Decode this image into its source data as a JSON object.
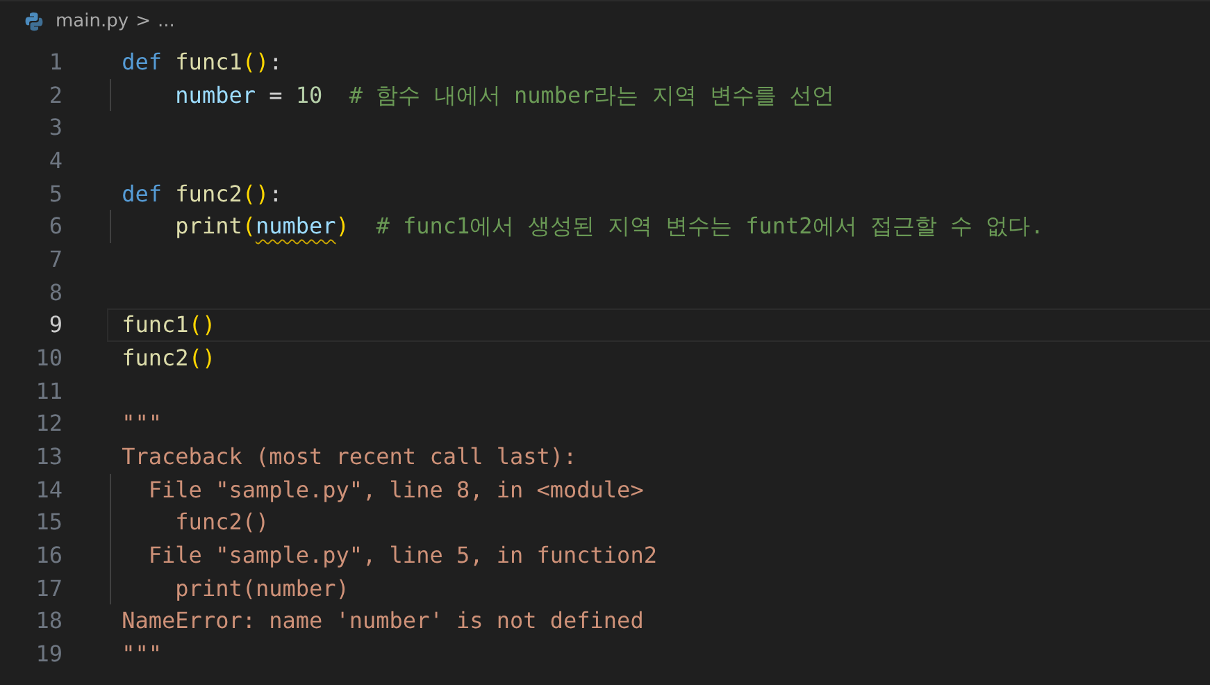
{
  "breadcrumb": {
    "file": "main.py",
    "separator": ">",
    "tail": "..."
  },
  "lines": [
    {
      "number": "1",
      "active": false,
      "tokens": [
        {
          "kind": "keyword",
          "text": "def "
        },
        {
          "kind": "function",
          "text": "func1"
        },
        {
          "kind": "bracket",
          "text": "()"
        },
        {
          "kind": "plain",
          "text": ":"
        }
      ]
    },
    {
      "number": "2",
      "active": false,
      "tokens": [
        {
          "kind": "variable",
          "text": "    number"
        },
        {
          "kind": "plain",
          "text": " = "
        },
        {
          "kind": "number",
          "text": "10"
        },
        {
          "kind": "comment",
          "text": "  # 함수 내에서 number라는 지역 변수를 선언"
        }
      ]
    },
    {
      "number": "3",
      "active": false
    },
    {
      "number": "4",
      "active": false
    },
    {
      "number": "5",
      "active": false,
      "tokens": [
        {
          "kind": "keyword",
          "text": "def "
        },
        {
          "kind": "function",
          "text": "func2"
        },
        {
          "kind": "bracket",
          "text": "()"
        },
        {
          "kind": "plain",
          "text": ":"
        }
      ]
    },
    {
      "number": "6",
      "active": false,
      "tokens": [
        {
          "kind": "function",
          "text": "    print"
        },
        {
          "kind": "bracket",
          "text": "("
        },
        {
          "kind": "warning",
          "text": "number"
        },
        {
          "kind": "bracket",
          "text": ")"
        },
        {
          "kind": "comment",
          "text": "  # func1에서 생성된 지역 변수는 funt2에서 접근할 수 없다."
        }
      ]
    },
    {
      "number": "7",
      "active": false
    },
    {
      "number": "8",
      "active": false
    },
    {
      "number": "9",
      "active": true,
      "tokens": [
        {
          "kind": "function",
          "text": "func1"
        },
        {
          "kind": "bracket",
          "text": "()"
        }
      ]
    },
    {
      "number": "10",
      "active": false,
      "tokens": [
        {
          "kind": "function",
          "text": "func2"
        },
        {
          "kind": "bracket",
          "text": "()"
        }
      ]
    },
    {
      "number": "11",
      "active": false
    },
    {
      "number": "12",
      "active": false,
      "tokens": [
        {
          "kind": "string",
          "text": "\"\"\""
        }
      ]
    },
    {
      "number": "13",
      "active": false,
      "tokens": [
        {
          "kind": "string",
          "text": "Traceback (most recent call last):"
        }
      ]
    },
    {
      "number": "14",
      "active": false,
      "tokens": [
        {
          "kind": "string",
          "text": "  File \"sample.py\", line 8, in <module>"
        }
      ]
    },
    {
      "number": "15",
      "active": false,
      "tokens": [
        {
          "kind": "string",
          "text": "    func2()"
        }
      ]
    },
    {
      "number": "16",
      "active": false,
      "tokens": [
        {
          "kind": "string",
          "text": "  File \"sample.py\", line 5, in function2"
        }
      ]
    },
    {
      "number": "17",
      "active": false,
      "tokens": [
        {
          "kind": "string",
          "text": "    print(number)"
        }
      ]
    },
    {
      "number": "18",
      "active": false,
      "tokens": [
        {
          "kind": "string",
          "text": "NameError: name 'number' is not defined"
        }
      ]
    },
    {
      "number": "19",
      "active": false,
      "tokens": [
        {
          "kind": "string",
          "text": "\"\"\""
        }
      ]
    }
  ]
}
